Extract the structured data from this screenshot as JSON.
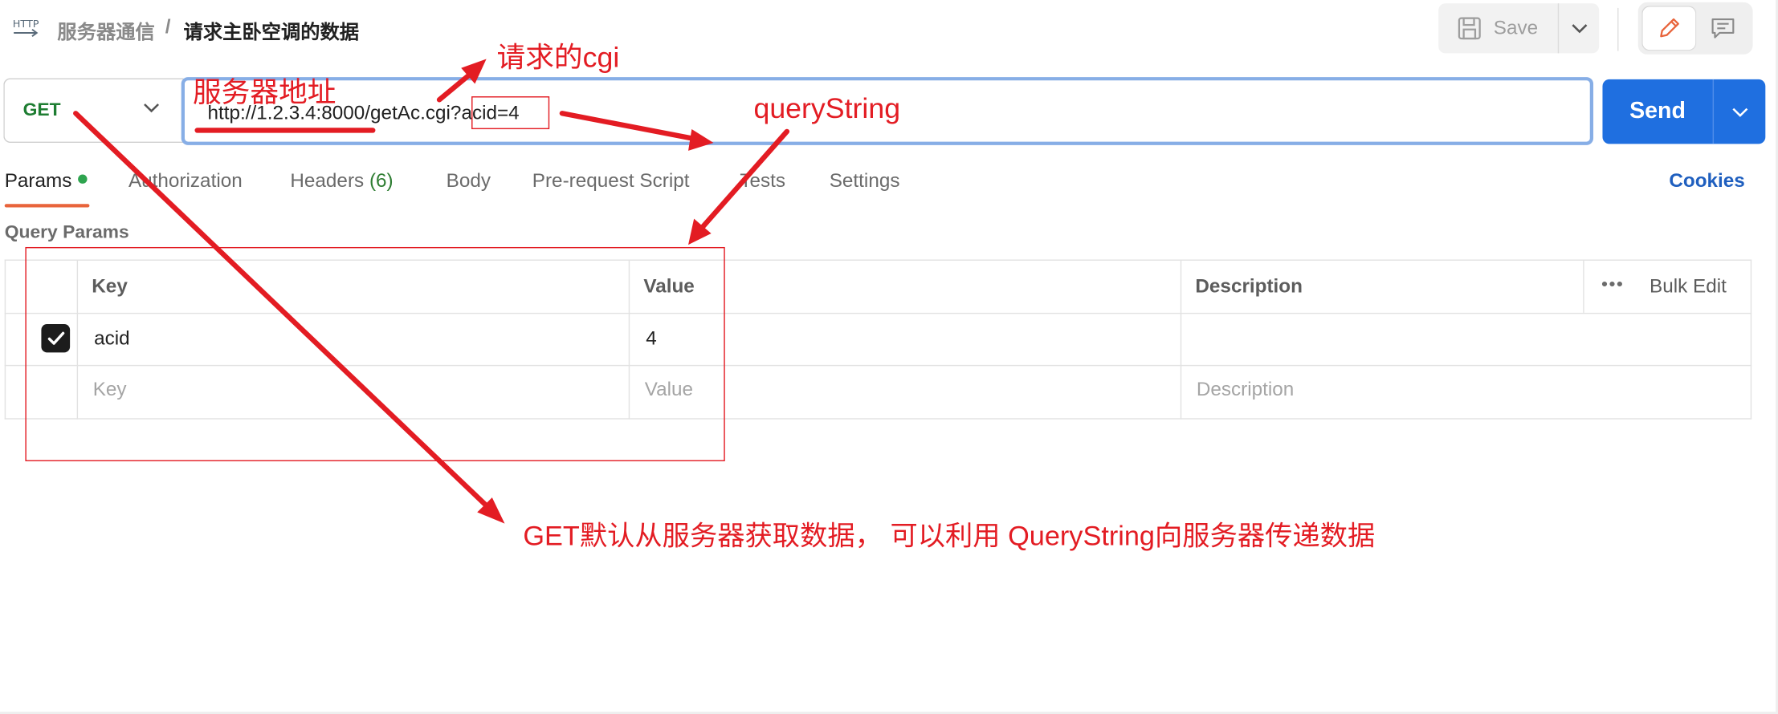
{
  "header": {
    "http_icon": "http-icon",
    "breadcrumb_parent": "服务器通信",
    "breadcrumb_separator": "/",
    "breadcrumb_current": "请求主卧空调的数据",
    "save_label": "Save",
    "save_icon": "save-icon",
    "edit_icon": "pencil-icon",
    "comment_icon": "comment-icon"
  },
  "request": {
    "method": "GET",
    "url_base": "http://1.2.3.4:8000/getAc.cgi",
    "url_query": "?acid=4",
    "send_label": "Send"
  },
  "tabs": {
    "params": "Params",
    "authorization": "Authorization",
    "headers": "Headers",
    "headers_count": "(6)",
    "body": "Body",
    "pre_request": "Pre-request Script",
    "tests": "Tests",
    "settings": "Settings",
    "cookies": "Cookies"
  },
  "query_params": {
    "title": "Query Params",
    "columns": {
      "key": "Key",
      "value": "Value",
      "description": "Description"
    },
    "bulk_edit": "Bulk Edit",
    "more_icon": "more-horizontal-icon",
    "rows": [
      {
        "checked": true,
        "key": "acid",
        "value": "4",
        "description": ""
      }
    ],
    "placeholder": {
      "key": "Key",
      "value": "Value",
      "description": "Description"
    }
  },
  "annotations": {
    "server_address": "服务器地址",
    "request_cgi": "请求的cgi",
    "query_string": "queryString",
    "note": "GET默认从服务器获取数据，  可以利用 QueryString向服务器传递数据",
    "color": "#e31c23"
  },
  "colors": {
    "send_blue": "#1f6fe0",
    "url_focus_border": "#87aee6",
    "method_green": "#1e7d32",
    "tab_active_underline": "#e8643b",
    "cookies_link": "#1f5fbf"
  }
}
